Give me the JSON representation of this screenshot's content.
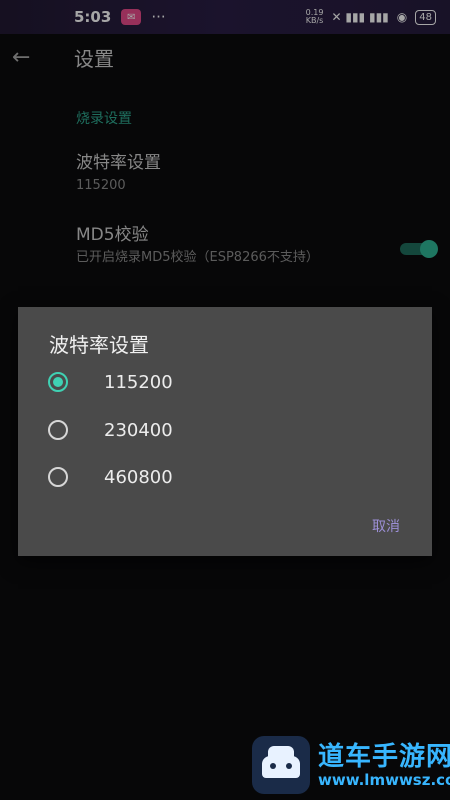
{
  "status_bar": {
    "time": "5:03",
    "more": "···",
    "net_speed": "0.19\nKB/s",
    "signal_icons": "ℕ ⅈıl ıl",
    "battery": "48"
  },
  "header": {
    "back_icon": "arrow-left-icon",
    "title": "设置"
  },
  "settings": {
    "section_title": "烧录设置",
    "baud": {
      "title": "波特率设置",
      "summary": "115200"
    },
    "md5": {
      "title": "MD5校验",
      "summary": "已开启烧录MD5校验（ESP8266不支持）",
      "enabled": true
    }
  },
  "dialog": {
    "title": "波特率设置",
    "options": [
      {
        "label": "115200",
        "selected": true
      },
      {
        "label": "230400",
        "selected": false
      },
      {
        "label": "460800",
        "selected": false
      }
    ],
    "cancel_label": "取消"
  },
  "watermark": {
    "name": "道车手游网",
    "url": "www.lmwwsz.com"
  },
  "colors": {
    "accent": "#3fd1b3",
    "section": "#2fa88f",
    "dialog_bg": "#4a4a4a",
    "cancel": "#9c8fd6"
  }
}
